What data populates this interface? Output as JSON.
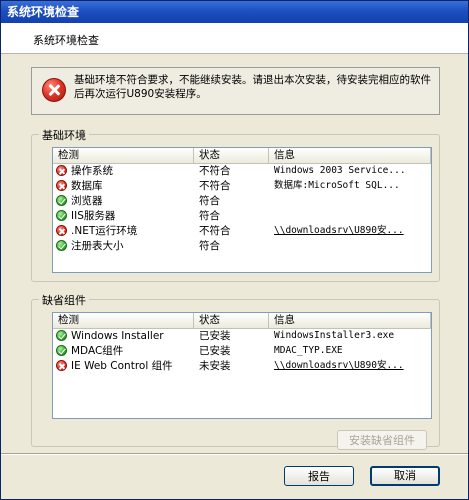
{
  "window": {
    "title": "系统环境检查"
  },
  "header": {
    "title": "系统环境检查"
  },
  "error_message": "基础环境不符合要求，不能继续安装。请退出本次安装，待安装完相应的软件后再次运行U890安装程序。",
  "basic_env": {
    "group_label": "基础环境",
    "columns": [
      "检测",
      "状态",
      "信息"
    ],
    "rows": [
      {
        "check": "操作系统",
        "status": "不符合",
        "info": "Windows 2003 Service...",
        "icon": "error-icon",
        "link": false
      },
      {
        "check": "数据库",
        "status": "不符合",
        "info": "数据库:MicroSoft SQL...",
        "icon": "error-icon",
        "link": false
      },
      {
        "check": "浏览器",
        "status": "符合",
        "info": "",
        "icon": "check-icon",
        "link": false
      },
      {
        "check": "IIS服务器",
        "status": "符合",
        "info": "",
        "icon": "check-icon",
        "link": false
      },
      {
        "check": ".NET运行环境",
        "status": "不符合",
        "info": "\\\\downloadsrv\\U890安...",
        "icon": "error-icon",
        "link": true
      },
      {
        "check": "注册表大小",
        "status": "符合",
        "info": "",
        "icon": "check-icon",
        "link": false
      }
    ]
  },
  "missing_components": {
    "group_label": "缺省组件",
    "columns": [
      "检测",
      "状态",
      "信息"
    ],
    "rows": [
      {
        "check": "Windows Installer",
        "status": "已安装",
        "info": "WindowsInstaller3.exe",
        "icon": "check-icon",
        "link": false
      },
      {
        "check": "MDAC组件",
        "status": "已安装",
        "info": "MDAC_TYP.EXE",
        "icon": "check-icon",
        "link": false
      },
      {
        "check": "IE Web Control 组件",
        "status": "未安装",
        "info": "\\\\downloadsrv\\U890安...",
        "icon": "error-icon",
        "link": true
      }
    ],
    "install_button": "安装缺省组件"
  },
  "footer": {
    "report_button": "报告",
    "cancel_button": "取消"
  }
}
